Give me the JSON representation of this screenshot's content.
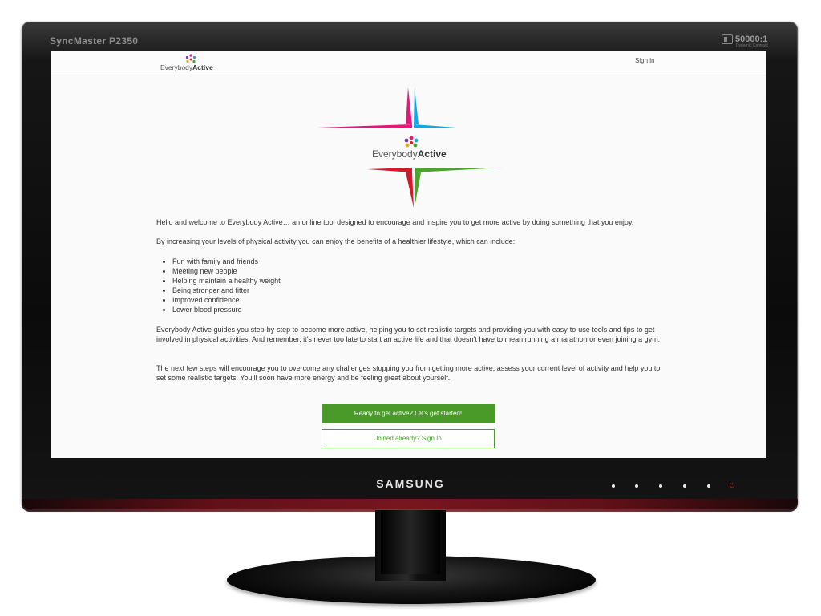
{
  "monitor": {
    "model": "SyncMaster P2350",
    "contrast": "50000:1",
    "contrast_sub": "Dynamic Contrast",
    "brand": "SAMSUNG"
  },
  "topbar": {
    "logo_prefix": "Everybody",
    "logo_suffix": "Active",
    "signin_label": "Sign in"
  },
  "hero": {
    "logo_prefix": "Everybody",
    "logo_suffix": "Active",
    "colors": {
      "magenta": "#e0197a",
      "blue": "#1aa3dc",
      "red": "#d11a2a",
      "green": "#4aa62a"
    }
  },
  "content": {
    "intro": "Hello and welcome to Everybody Active… an online tool designed to encourage and inspire you to get more active by doing something that you enjoy.",
    "benefits_intro": "By increasing your levels of physical activity you can enjoy the benefits of a healthier lifestyle, which can include:",
    "benefits": [
      "Fun with family and friends",
      "Meeting new people",
      "Helping maintain a healthy weight",
      "Being stronger and fitter",
      "Improved confidence",
      "Lower blood pressure"
    ],
    "guide": "Everybody Active guides you step-by-step to become more active, helping you to set realistic targets and providing you with easy-to-use tools and tips to get involved in physical activities. And remember, it’s never too late to start an active life and that doesn’t have to mean running a marathon or even joining a gym.",
    "next_steps": "The next few steps will encourage you to overcome any challenges stopping you from getting more active, assess your current level of activity and help you to set some realistic targets. You’ll soon have more energy and be feeling great about yourself."
  },
  "actions": {
    "start_label": "Ready to get active? Let’s get started!",
    "signin_label": "Joined already? Sign In",
    "accent": "#4a9a2a"
  }
}
